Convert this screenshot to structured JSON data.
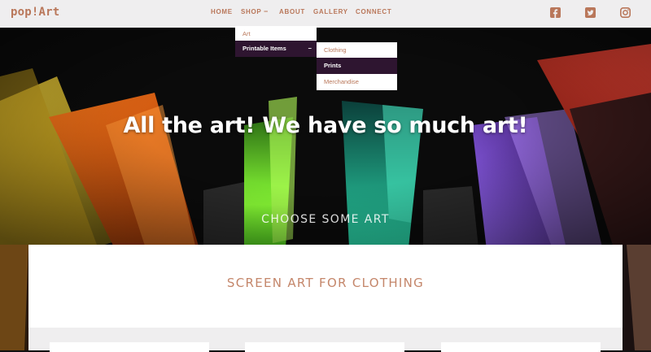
{
  "header": {
    "logo": "pop!Art",
    "nav": {
      "home": "HOME",
      "shop": "SHOP",
      "shop_caret": "−",
      "about": "ABOUT",
      "gallery": "GALLERY",
      "connect": "CONNECT"
    },
    "social": [
      "facebook-icon",
      "twitter-icon",
      "instagram-icon"
    ]
  },
  "dropdown": {
    "level1": {
      "art": "Art",
      "printable_items": "Printable Items",
      "printable_caret": "−"
    },
    "level2": {
      "clothing": "Clothing",
      "prints": "Prints",
      "merchandise": "Merchandise"
    }
  },
  "hero": {
    "title": "All the art! We have so much art!",
    "cta": "CHOOSE SOME ART"
  },
  "section": {
    "title": "SCREEN ART FOR CLOTHING"
  },
  "colors": {
    "accent": "#b9775a",
    "header_bg": "#efeeef",
    "dropdown_active_bg": "#2e1530"
  }
}
